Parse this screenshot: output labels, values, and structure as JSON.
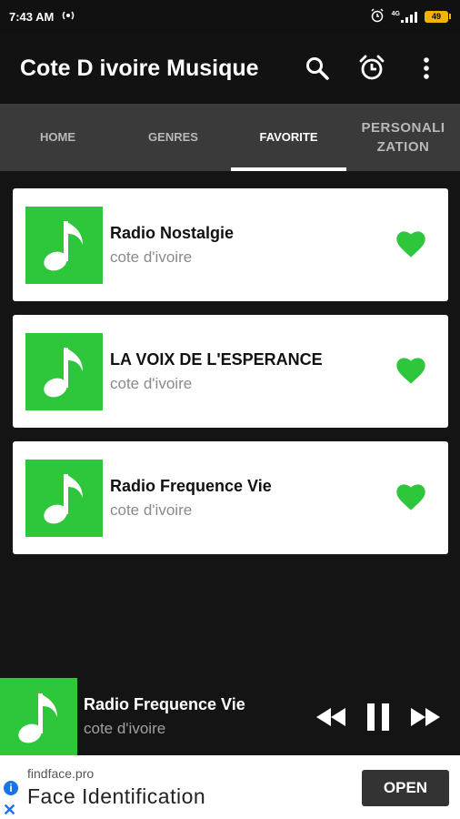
{
  "status": {
    "time": "7:43 AM",
    "network": "4G",
    "battery": "49"
  },
  "app": {
    "title": "Cote D ivoire Musique"
  },
  "tabs": [
    {
      "label": "HOME",
      "active": false
    },
    {
      "label": "GENRES",
      "active": false
    },
    {
      "label": "FAVORITE",
      "active": true
    },
    {
      "label": "PERSONALI ZATION",
      "active": false
    }
  ],
  "favorites": [
    {
      "title": "Radio Nostalgie",
      "subtitle": "cote d'ivoire"
    },
    {
      "title": "LA VOIX DE L'ESPERANCE",
      "subtitle": "cote d'ivoire"
    },
    {
      "title": "Radio Frequence Vie",
      "subtitle": "cote d'ivoire"
    }
  ],
  "player": {
    "title": "Radio Frequence Vie",
    "subtitle": "cote d'ivoire"
  },
  "ad": {
    "domain": "findface.pro",
    "title": "Face Identification",
    "cta": "OPEN",
    "info": "i",
    "close": "✕"
  },
  "colors": {
    "accent": "#2ec63a",
    "background": "#141414",
    "tabs": "#3a3a3a"
  }
}
